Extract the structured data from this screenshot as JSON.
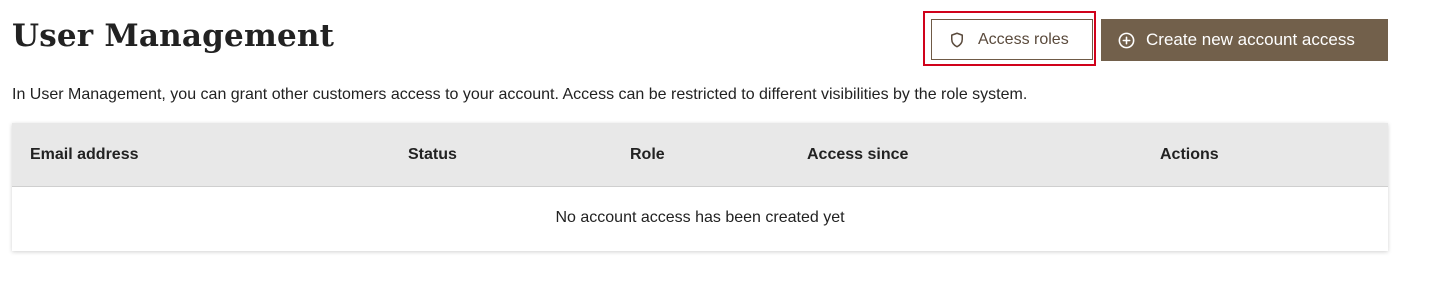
{
  "header": {
    "title": "User Management"
  },
  "toolbar": {
    "access_roles_label": "Access roles",
    "access_roles_icon": "shield-icon",
    "create_label": "Create new account access",
    "create_icon": "plus-circle-icon",
    "highlight_color": "#d0021b",
    "accent_color": "#72604b"
  },
  "intro": {
    "text": "In User Management, you can grant other customers access to your account. Access can be restricted to different visibilities by the role system."
  },
  "table": {
    "columns": [
      "Email address",
      "Status",
      "Role",
      "Access since",
      "Actions"
    ],
    "empty_message": "No account access has been created yet"
  }
}
